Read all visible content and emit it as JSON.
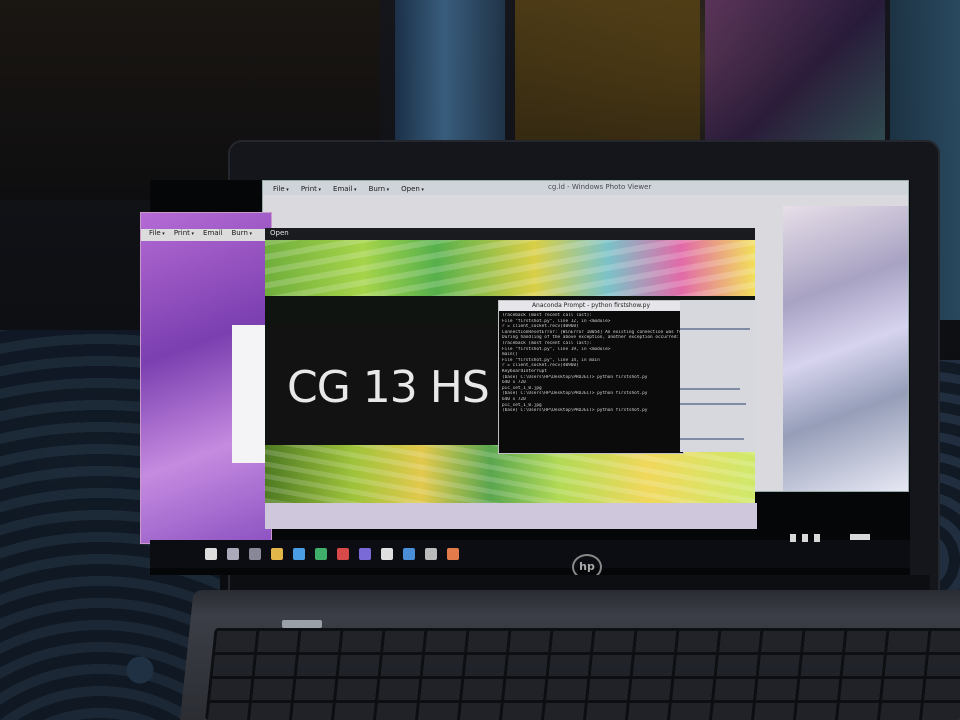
{
  "scene": {
    "description_elements": [
      "laptop",
      "screen",
      "keyboard",
      "bedsheet"
    ]
  },
  "photo_viewer_back": {
    "menu": [
      "File",
      "Print",
      "Email",
      "Burn",
      "Open"
    ],
    "title": "cg.ld - Windows Photo Viewer"
  },
  "photo_viewer_front": {
    "menu": [
      "File",
      "Print",
      "Email",
      "Burn"
    ]
  },
  "photo": {
    "toolbar_label": "Open",
    "text": "CG 13 HS"
  },
  "anaconda_prompt": {
    "title": "Anaconda Prompt - python  firstshow.py",
    "lines": [
      "Traceback (most recent call last):",
      "  File \"firstshot.py\", line 12, in <module>",
      "    r = client_socket.recv(40960)",
      "ConnectionResetError: [WinError 10054] An existing connection was forcibly closed by the remote host",
      "",
      "During handling of the above exception, another exception occurred:",
      "",
      "Traceback (most recent call last):",
      "  File \"firstshot.py\", line 19, in <module>",
      "    main()",
      "  File \"firstshot.py\", line 14, in main",
      "    r = client_socket.recv(40960)",
      "KeyboardInterrupt",
      "",
      "(base) C:\\Users\\HP\\Desktop\\PROJECT> python firstshot.py",
      "640 x 720",
      "pic_set_1_0.jpg",
      "",
      "(base) C:\\Users\\HP\\Desktop\\PROJECT> python firstshot.py",
      "640 x 720",
      "pic_set_1_0.jpg",
      "",
      "(base) C:\\Users\\HP\\Desktop\\PROJECT> python firstshot.py"
    ]
  },
  "laptop": {
    "brand_logo": "hp"
  },
  "taskbar": {
    "icons": [
      "start-icon",
      "search-icon",
      "task-view-icon",
      "file-explorer-icon",
      "chrome-icon",
      "edge-icon",
      "store-icon",
      "mail-icon",
      "photos-icon",
      "python-icon",
      "settings-icon",
      "media-icon"
    ]
  }
}
